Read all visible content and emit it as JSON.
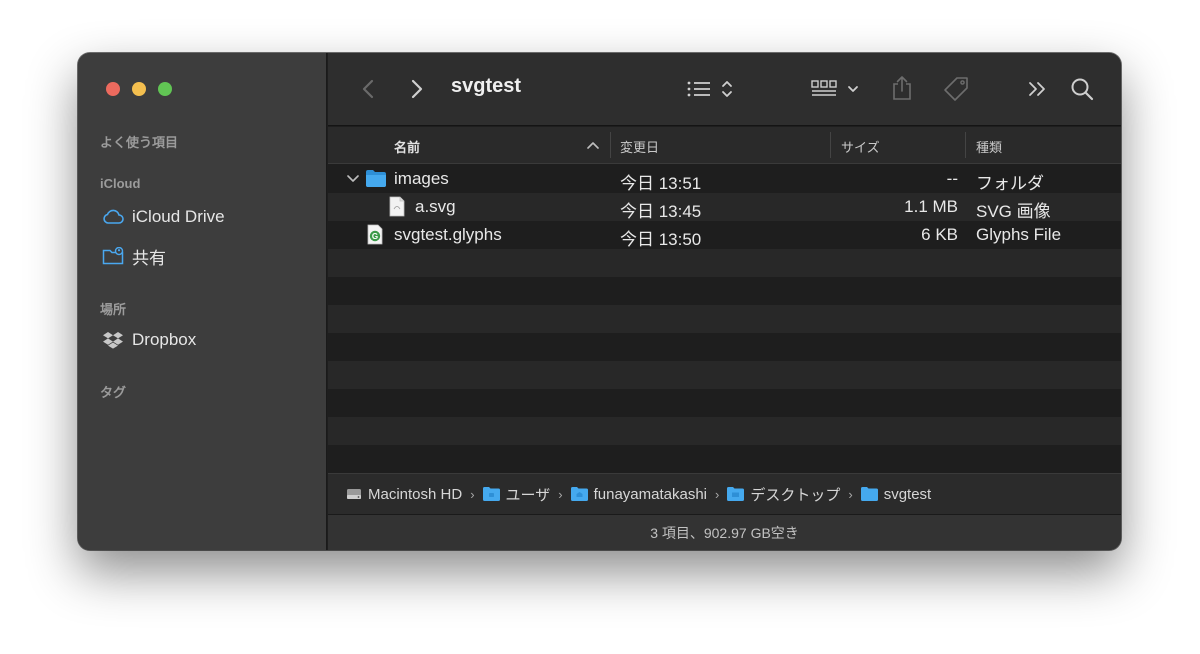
{
  "window": {
    "title": "svgtest"
  },
  "sidebar": {
    "sections": {
      "favorites": "よく使う項目",
      "icloud": "iCloud",
      "locations": "場所",
      "tags": "タグ"
    },
    "items": {
      "icloud_drive": "iCloud Drive",
      "shared": "共有",
      "dropbox": "Dropbox"
    }
  },
  "toolbar": {
    "title": "svgtest",
    "icons": [
      "back-icon",
      "forward-icon",
      "list-view-icon",
      "gallery-view-icon",
      "share-icon",
      "tag-icon",
      "more-icon",
      "search-icon"
    ]
  },
  "columns": {
    "name": "名前",
    "modified": "変更日",
    "size": "サイズ",
    "kind": "種類"
  },
  "files": [
    {
      "name": "images",
      "modified": "今日 13:51",
      "size": "--",
      "kind": "フォルダ",
      "type": "folder",
      "expanded": true,
      "indent": 0
    },
    {
      "name": "a.svg",
      "modified": "今日 13:45",
      "size": "1.1 MB",
      "kind": "SVG 画像",
      "type": "svg",
      "indent": 1
    },
    {
      "name": "svgtest.glyphs",
      "modified": "今日 13:50",
      "size": "6 KB",
      "kind": "Glyphs File",
      "type": "glyphs",
      "indent": 0
    }
  ],
  "pathbar": [
    "Macintosh HD",
    "ユーザ",
    "funayamatakashi",
    "デスクトップ",
    "svgtest"
  ],
  "status": "3 項目、902.97 GB空き",
  "colors": {
    "sidebar": "#3d3d3d",
    "toolbar": "#2e2e2e",
    "folder": "#3aa0e6",
    "accent_close": "#ec6a5e",
    "accent_min": "#f4bf4f",
    "accent_max": "#61c554"
  }
}
